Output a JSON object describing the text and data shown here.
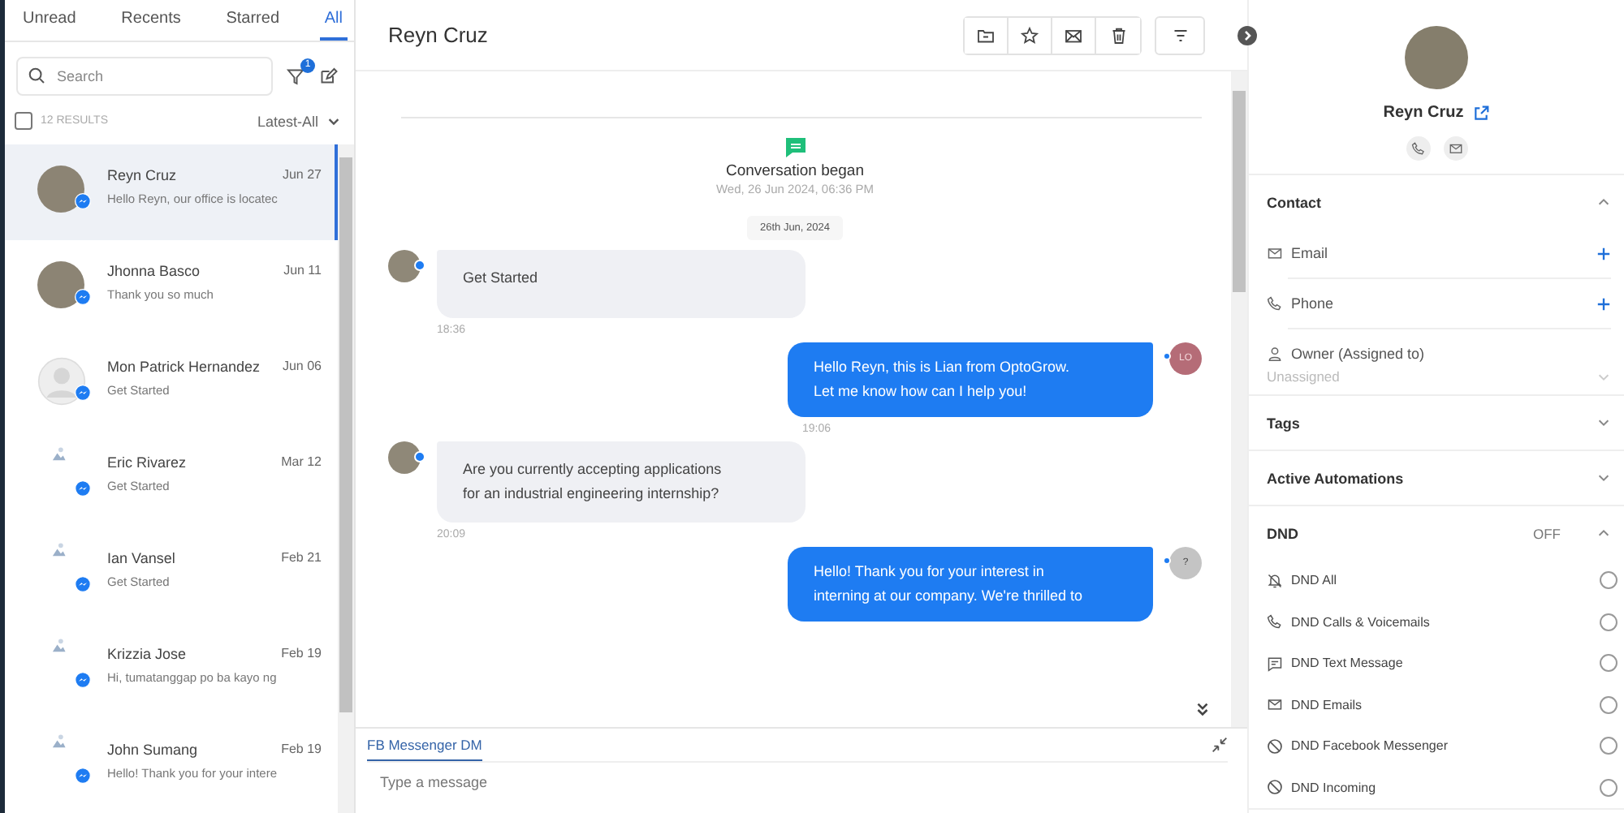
{
  "inbox_tabs": [
    {
      "label": "Unread",
      "selected": false
    },
    {
      "label": "Recents",
      "selected": false
    },
    {
      "label": "Starred",
      "selected": false
    },
    {
      "label": "All",
      "selected": true
    }
  ],
  "search": {
    "placeholder": "Search"
  },
  "filter_badge": "1",
  "results": {
    "count": "12 RESULTS",
    "checked": false,
    "sort": "Latest-All"
  },
  "conversations": [
    {
      "name": "Reyn Cruz",
      "date": "Jun 27",
      "preview": "Hello Reyn, our office is locatec",
      "kind": "photo",
      "selected": true
    },
    {
      "name": "Jhonna Basco",
      "date": "Jun 11",
      "preview": "Thank you so much",
      "kind": "photo",
      "selected": false
    },
    {
      "name": "Mon Patrick Hernandez",
      "date": "Jun 06",
      "preview": "Get Started",
      "kind": "silhouette",
      "selected": false
    },
    {
      "name": "Eric Rivarez",
      "date": "Mar 12",
      "preview": "Get Started",
      "kind": "broken",
      "selected": false
    },
    {
      "name": "Ian Vansel",
      "date": "Feb 21",
      "preview": "Get Started",
      "kind": "broken",
      "selected": false
    },
    {
      "name": "Krizzia Jose",
      "date": "Feb 19",
      "preview": "Hi, tumatanggap po ba kayo ng",
      "kind": "broken",
      "selected": false
    },
    {
      "name": "John Sumang",
      "date": "Feb 19",
      "preview": "Hello! Thank you for your intere",
      "kind": "broken",
      "selected": false
    }
  ],
  "chat": {
    "title": "Reyn Cruz",
    "began": "Conversation began",
    "began_time": "Wed, 26 Jun 2024, 06:36 PM",
    "day": "26th Jun, 2024",
    "messages": [
      {
        "kind": "incoming",
        "text": "Get Started",
        "time": "18:36"
      },
      {
        "kind": "outgoing",
        "text": "Hello Reyn, this is Lian from OptoGrow.\nLet me know how can I help you!",
        "time": "19:06",
        "avatar_text": "LO"
      },
      {
        "kind": "incoming",
        "text": "Are you currently accepting applications\nfor an industrial engineering internship?",
        "time": "20:09"
      },
      {
        "kind": "outgoing",
        "text": "Hello! Thank you for your interest in\ninterning at our company. We're thrilled to",
        "avatar_text": "?"
      }
    ],
    "channel_tab": "FB Messenger DM",
    "composer": {
      "placeholder": "Type a message"
    }
  },
  "contact": {
    "name": "Reyn Cruz",
    "sections": [
      {
        "title": "Contact",
        "expanded": true,
        "kind": "contact",
        "fields": [
          {
            "label": "Email",
            "kind": "email"
          },
          {
            "label": "Phone",
            "kind": "phone"
          },
          {
            "label": "Owner (Assigned to)",
            "kind": "owner",
            "value": "Unassigned"
          }
        ]
      },
      {
        "title": "Tags",
        "expanded": false
      },
      {
        "title": "Active Automations",
        "expanded": false
      },
      {
        "title": "DND",
        "expanded": true,
        "kind": "dnd",
        "status": "OFF",
        "options": [
          {
            "label": "DND All",
            "checked": false
          },
          {
            "label": "DND Calls & Voicemails",
            "checked": false
          },
          {
            "label": "DND Text Message",
            "checked": false
          },
          {
            "label": "DND Emails",
            "checked": false
          },
          {
            "label": "DND Facebook Messenger",
            "checked": false
          },
          {
            "label": "DND Incoming",
            "checked": false
          }
        ]
      }
    ]
  }
}
